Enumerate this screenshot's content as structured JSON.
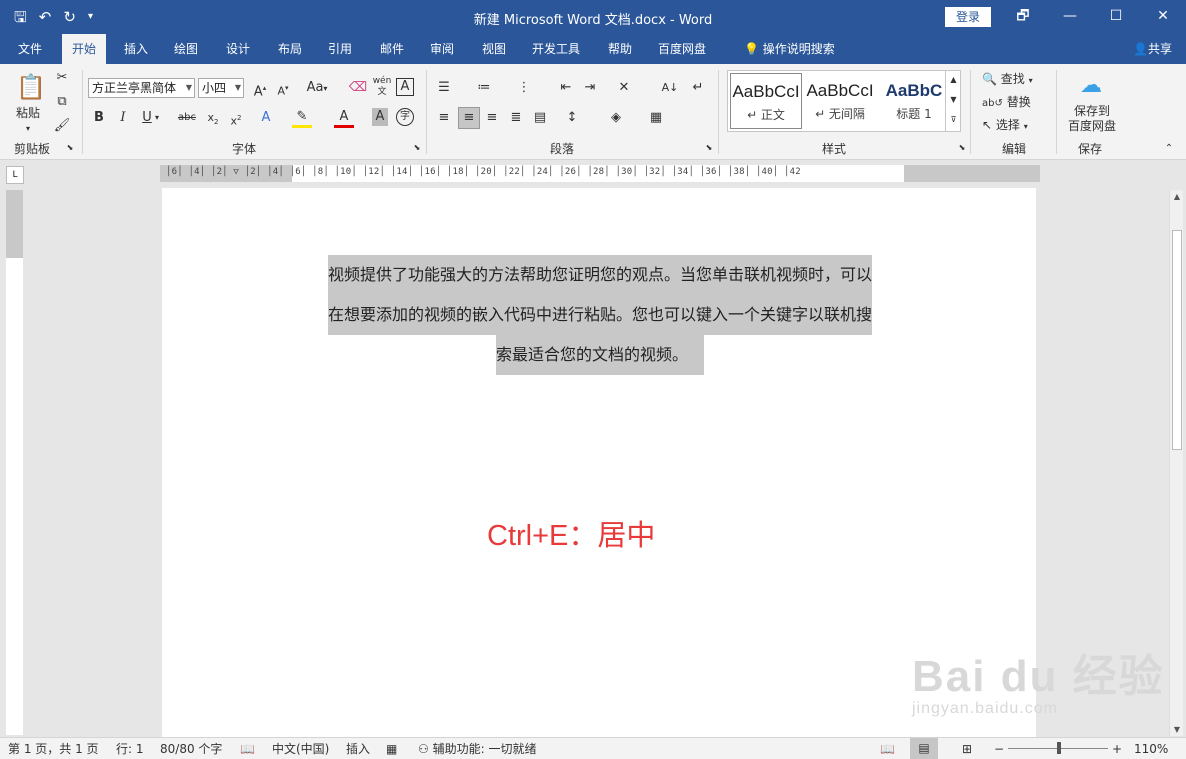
{
  "app": {
    "title": "新建 Microsoft Word 文档.docx  -  Word",
    "login_label": "登录",
    "qat": {
      "save_glyph": "🖫",
      "undo_glyph": "↶",
      "redo_glyph": "↻",
      "customize_glyph": "▾"
    },
    "window": {
      "restore_glyph": "🗗",
      "minimize_glyph": "—",
      "maximize_glyph": "☐",
      "close_glyph": "✕"
    }
  },
  "tabs": [
    {
      "label": "文件"
    },
    {
      "label": "开始"
    },
    {
      "label": "插入"
    },
    {
      "label": "绘图"
    },
    {
      "label": "设计"
    },
    {
      "label": "布局"
    },
    {
      "label": "引用"
    },
    {
      "label": "邮件"
    },
    {
      "label": "审阅"
    },
    {
      "label": "视图"
    },
    {
      "label": "开发工具"
    },
    {
      "label": "帮助"
    },
    {
      "label": "百度网盘"
    },
    {
      "label": "操作说明搜索"
    }
  ],
  "active_tab": "开始",
  "share_label": "共享",
  "ribbon": {
    "clipboard": {
      "label": "剪贴板",
      "paste_label": "粘贴"
    },
    "font": {
      "label": "字体",
      "font_name": "方正兰亭黑简体",
      "font_size": "小四",
      "aa_label": "Aa",
      "wen_label": "wén",
      "a_box_label": "A",
      "font_color": "#e00000"
    },
    "paragraph": {
      "label": "段落"
    },
    "styles": {
      "label": "样式",
      "items": [
        {
          "preview": "AaBbCcI",
          "name": "↵ 正文"
        },
        {
          "preview": "AaBbCcI",
          "name": "↵ 无间隔"
        },
        {
          "preview": "AaBbC",
          "name": "标题 1"
        }
      ]
    },
    "editing": {
      "label": "编辑",
      "find": "查找",
      "replace": "替换",
      "select": "选择"
    },
    "save": {
      "label": "保存",
      "button_label": "保存到\n百度网盘"
    }
  },
  "ruler": {
    "corner": "L",
    "h_text": "│6│  │4│  │2│  ▽  │2│  │4│  │6│  │8│  │10│ │12│ │14│ │16│ │18│ │20│ │22│ │24│ │26│ │28│ │30│ │32│ │34│ │36│ │38│ │40│ │42"
  },
  "document": {
    "lines": [
      "视频提供了功能强大的方法帮助您证明您的观点。当您单击联机视频时，可以",
      "在想要添加的视频的嵌入代码中进行粘贴。您也可以键入一个关键字以联机搜",
      "索最适合您的文档的视频。"
    ],
    "caption": "Ctrl+E：居中"
  },
  "watermark": {
    "main": "Bai du 经验",
    "sub": "jingyan.baidu.com"
  },
  "status": {
    "page": "第 1 页，共 1 页",
    "line": "行: 1",
    "words": "80/80 个字",
    "language": "中文(中国)",
    "insert_mode": "插入",
    "accessibility": "辅助功能: 一切就绪",
    "zoom": "110%"
  }
}
